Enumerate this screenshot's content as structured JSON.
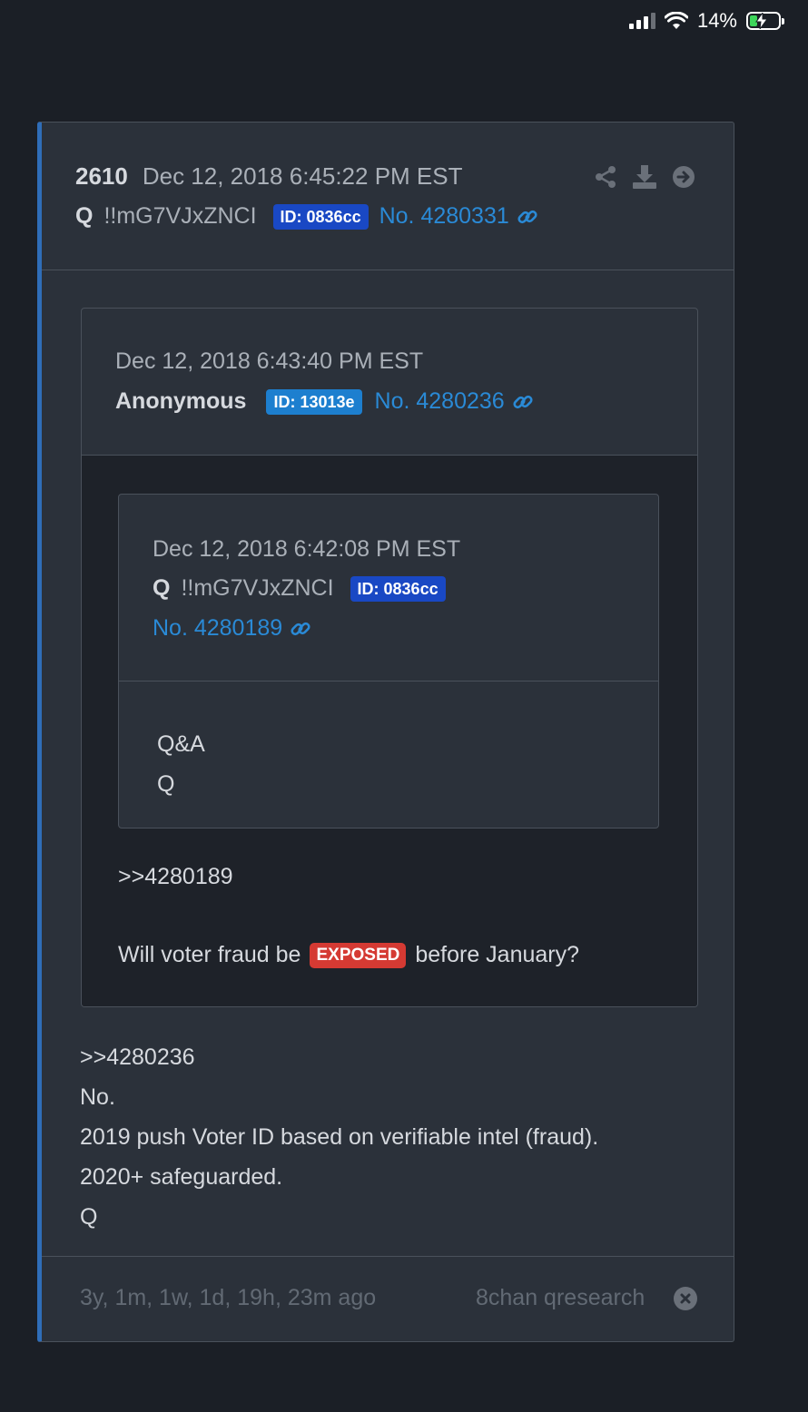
{
  "status_bar": {
    "battery_percent": "14%",
    "battery_level": 0.14
  },
  "post": {
    "number": "2610",
    "date": "Dec 12, 2018 6:45:22 PM EST",
    "author": "Q",
    "tripcode": "!!mG7VJxZNCI",
    "id_badge": "ID: 0836cc",
    "post_no": "No. 4280331",
    "reply_lines": [
      ">>4280236",
      "No.",
      "2019 push Voter ID based on verifiable intel (fraud).",
      "2020+ safeguarded.",
      "Q"
    ]
  },
  "quoted_post": {
    "date": "Dec 12, 2018 6:43:40 PM EST",
    "author": "Anonymous",
    "id_badge": "ID: 13013e",
    "post_no": "No. 4280236",
    "reply_ref": ">>4280189",
    "question_before": "Will voter fraud be",
    "question_highlight": "EXPOSED",
    "question_after": "before January?"
  },
  "nested_quote": {
    "date": "Dec 12, 2018 6:42:08 PM EST",
    "author": "Q",
    "tripcode": "!!mG7VJxZNCI",
    "id_badge": "ID: 0836cc",
    "post_no": "No. 4280189",
    "lines": [
      "Q&A",
      "Q"
    ]
  },
  "footer": {
    "ago": "3y, 1m, 1w, 1d, 19h, 23m ago",
    "source": "8chan qresearch"
  },
  "colors": {
    "accent_bar": "#2f6db8",
    "link": "#2a8ad6",
    "id_badge_q": "#1948c4",
    "id_badge_anon": "#1d7fcf",
    "exposed_badge": "#d53a33",
    "battery_fill": "#3dd55a"
  }
}
